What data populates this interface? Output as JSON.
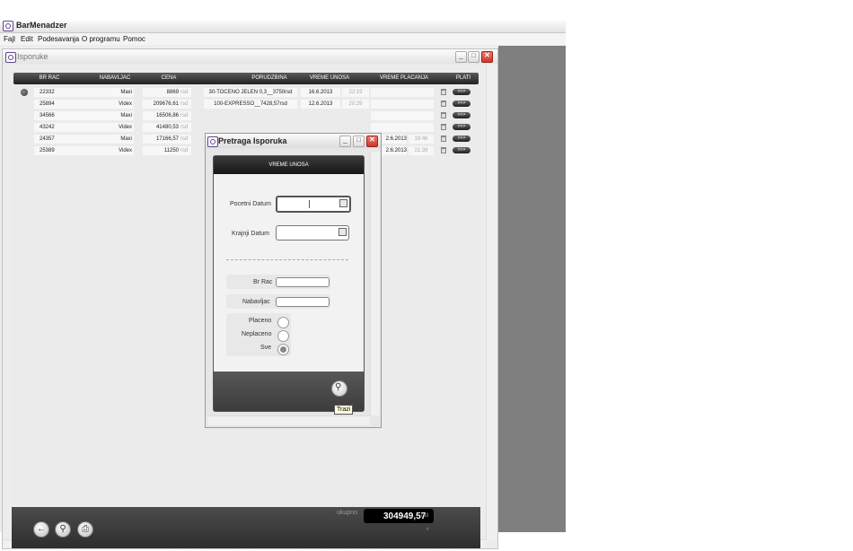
{
  "app": {
    "title": "BarMenadzer",
    "menu": [
      "Fajl",
      "Edit",
      "Podesavanja",
      "O programu",
      "Pomoc"
    ]
  },
  "isporuke": {
    "title": "Isporuke",
    "columns": [
      "BR RAC",
      "NABAVLJAC",
      "CENA",
      "PORUDZBINA",
      "VREME UNOSA",
      "VREME PLACANJA",
      "PLATI"
    ],
    "rows": [
      {
        "br": "22332",
        "nab": "Maxi",
        "cena": "8869",
        "cur": "rsd",
        "por": "30-TOCENO JELEN 0,3__3750rsd",
        "unos_d": "16.6.2013",
        "unos_t": "22:19",
        "plac_d": "",
        "plac_t": "",
        "plati": ">>>"
      },
      {
        "br": "25894",
        "nab": "Videx",
        "cena": "209676,61",
        "cur": "rsd",
        "por": "100-EXPRESSO__7428,57rsd",
        "unos_d": "12.6.2013",
        "unos_t": "20:29",
        "plac_d": "",
        "plac_t": "",
        "plati": ">>>"
      },
      {
        "br": "34566",
        "nab": "Maxi",
        "cena": "16506,86",
        "cur": "rsd",
        "por": "",
        "unos_d": "",
        "unos_t": "",
        "plac_d": "",
        "plac_t": "",
        "plati": ">>>"
      },
      {
        "br": "43242",
        "nab": "Videx",
        "cena": "41480,53",
        "cur": "rsd",
        "por": "",
        "unos_d": "",
        "unos_t": "",
        "plac_d": "",
        "plac_t": "",
        "plati": ">>>"
      },
      {
        "br": "24357",
        "nab": "Maxi",
        "cena": "17166,57",
        "cur": "rsd",
        "por": "",
        "unos_d": "",
        "unos_t": "",
        "plac_d": "2.6.2013",
        "plac_t": "19:46",
        "plati": ">>>"
      },
      {
        "br": "25389",
        "nab": "Videx",
        "cena": "11250",
        "cur": "rsd",
        "por": "",
        "unos_d": "",
        "unos_t": "",
        "plac_d": "2.6.2013",
        "plac_t": "21:39",
        "plati": ">>>"
      }
    ],
    "ukupno_label": "ukupno",
    "ukupno_value": "304949,57",
    "ukupno_unit": "rsd",
    "footer_extra": "ti"
  },
  "dialog": {
    "title": "Pretraga Isporuka",
    "header": "VREME UNOSA",
    "pocetni_label": "Pocetni Datum",
    "pocetni_value": "",
    "krajnji_label": "Krajnji Datum",
    "krajnji_value": "",
    "brrac_label": "Br Rac",
    "brrac_value": "",
    "nab_label": "Nabavljac",
    "nab_value": "",
    "status_options": [
      "Placeno",
      "Neplaceno",
      "Sve"
    ],
    "status_selected": "Sve",
    "tooltip": "Trazi"
  }
}
